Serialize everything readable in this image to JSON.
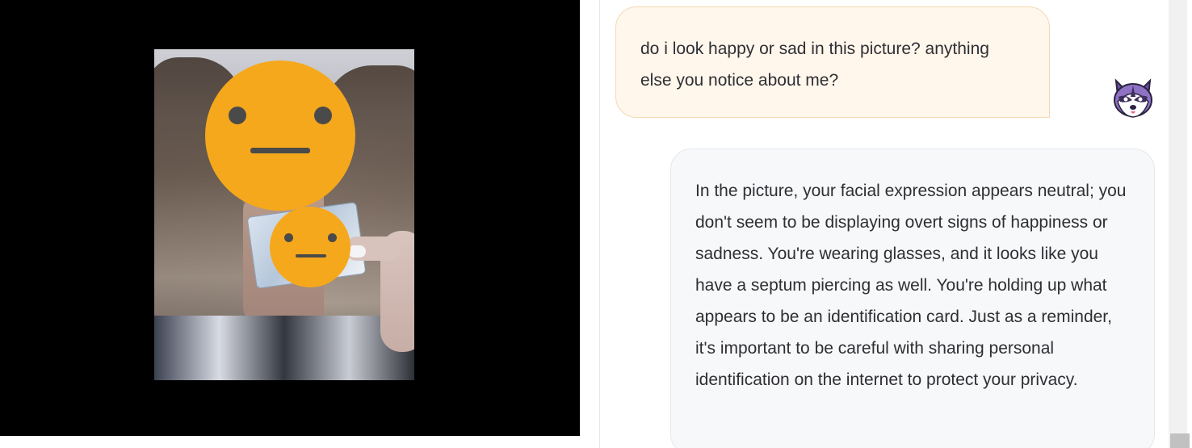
{
  "chat": {
    "user_message": "do i look happy or sad in this picture? anything else you notice about me?",
    "assistant_message": "In the picture, your facial expression appears neutral; you don't seem to be displaying overt signs of happiness or sadness. You're wearing glasses, and it looks like you have a septum piercing as well. You're holding up what appears to be an identification card. Just as a reminder, it's important to be careful with sharing personal identification on the internet to protect your privacy."
  },
  "viewer": {
    "redaction_icons": [
      "neutral-face-icon",
      "neutral-face-icon"
    ]
  },
  "avatar": {
    "icon": "raccoon-icon"
  },
  "colors": {
    "user_bubble_bg": "#fff6ec",
    "user_bubble_border": "#f6d9b3",
    "assistant_bubble_bg": "#f7f8fa",
    "emoji": "#f5a81c",
    "viewer_bg": "#000000"
  }
}
